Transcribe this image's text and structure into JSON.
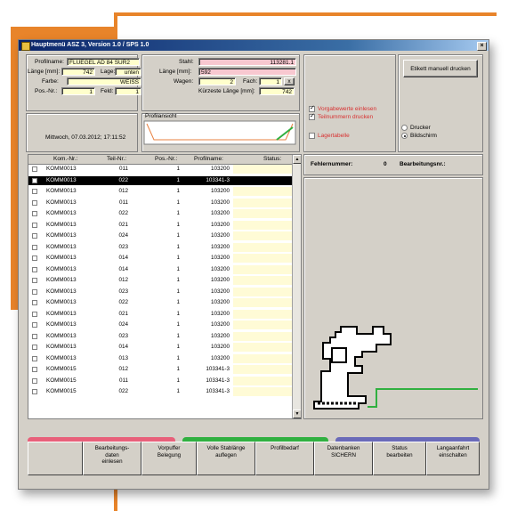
{
  "window": {
    "title": "Hauptmenü ASZ 3, Version 1.0 / SPS 1.0",
    "close": "×"
  },
  "profile": {
    "profilname_label": "Profilname:",
    "profilname": "FLUEGEL AD 84 SUR2",
    "laenge_label": "Länge [mm]:",
    "laenge": "742",
    "lage_label": "Lage:",
    "lage": "unten",
    "farbe_label": "Farbe:",
    "farbe": "WEISS",
    "posnr_label": "Pos.-Nr.:",
    "posnr": "1",
    "feld_label": "Feld:",
    "feld": "1"
  },
  "stahl": {
    "stahl_label": "Stahl:",
    "stahl": "113281.1",
    "laenge_label": "Länge [mm]:",
    "laenge": "592",
    "wagen_label": "Wagen:",
    "wagen": "2",
    "fach_label": "Fach:",
    "fach": "1",
    "fach_btn": "x",
    "kuerzeste_label": "Kürzeste Länge [mm]:",
    "kuerzeste": "742"
  },
  "status": {
    "date": "Mittwoch, 07.03.2012;  17:11:52",
    "profilansicht": "Profilansicht",
    "check1": "Vorgabewerte einlesen",
    "check2": "Teilnummern drucken",
    "check3": "Lagertabelle",
    "etikett_button": "Etikett manuell drucken",
    "radio_drucker": "Drucker",
    "radio_bildschirm": "Bildschirm"
  },
  "errors": {
    "fehler_label": "Fehlernummer:",
    "fehler_value": "0",
    "bearb_label": "Bearbeitungsnr.:"
  },
  "grid": {
    "headers": [
      "Kom.-Nr.:",
      "Teil-Nr.:",
      "Pos.-Nr.:",
      "Profilname:",
      "Status:"
    ],
    "rows": [
      [
        "KOMM0013",
        "011",
        "1",
        "103200"
      ],
      [
        "KOMM0013",
        "022",
        "1",
        "103341-3"
      ],
      [
        "KOMM0013",
        "012",
        "1",
        "103200"
      ],
      [
        "KOMM0013",
        "011",
        "1",
        "103200"
      ],
      [
        "KOMM0013",
        "022",
        "1",
        "103200"
      ],
      [
        "KOMM0013",
        "021",
        "1",
        "103200"
      ],
      [
        "KOMM0013",
        "024",
        "1",
        "103200"
      ],
      [
        "KOMM0013",
        "023",
        "1",
        "103200"
      ],
      [
        "KOMM0013",
        "014",
        "1",
        "103200"
      ],
      [
        "KOMM0013",
        "014",
        "1",
        "103200"
      ],
      [
        "KOMM0013",
        "012",
        "1",
        "103200"
      ],
      [
        "KOMM0013",
        "023",
        "1",
        "103200"
      ],
      [
        "KOMM0013",
        "022",
        "1",
        "103200"
      ],
      [
        "KOMM0013",
        "021",
        "1",
        "103200"
      ],
      [
        "KOMM0013",
        "024",
        "1",
        "103200"
      ],
      [
        "KOMM0013",
        "023",
        "1",
        "103200"
      ],
      [
        "KOMM0013",
        "014",
        "1",
        "103200"
      ],
      [
        "KOMM0013",
        "013",
        "1",
        "103200"
      ],
      [
        "KOMM0015",
        "012",
        "1",
        "103341-3"
      ],
      [
        "KOMM0015",
        "011",
        "1",
        "103341-3"
      ],
      [
        "KOMM0015",
        "022",
        "1",
        "103341-3"
      ]
    ]
  },
  "footer": {
    "b1": "Bearbeitungs-\ndaten\neinlesen",
    "b2": "Vorpuffer\nBelegung",
    "b3": "Volle Stablänge\nauflegen",
    "b4": "Profilbedarf",
    "b5": "Datenbanken\nSICHERN",
    "b6": "Status\nbearbeiten",
    "b7": "Langaanfahrt\neinschalten"
  },
  "colors": {
    "accent_orange": "#e8842a",
    "bar_pink": "#e8607a",
    "bar_green": "#30b040",
    "bar_blue": "#6a6ab8",
    "row_alt": "#fffbd6",
    "selected": "#000000"
  }
}
